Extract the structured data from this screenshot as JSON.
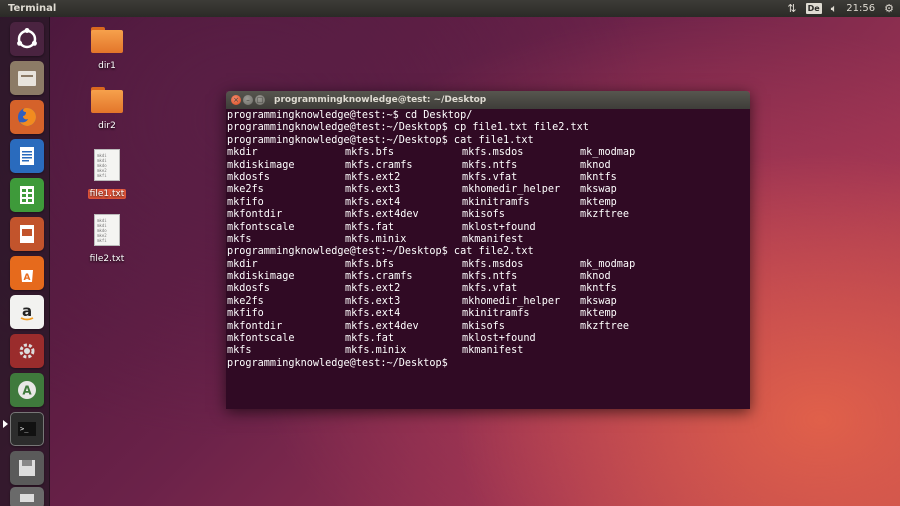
{
  "panel": {
    "app_title": "Terminal",
    "keyboard_layout": "De",
    "clock": "21:56"
  },
  "desktop": {
    "icons": [
      {
        "label": "dir1",
        "type": "folder"
      },
      {
        "label": "dir2",
        "type": "folder"
      },
      {
        "label": "file1.txt",
        "type": "text-file",
        "selected": true
      },
      {
        "label": "file2.txt",
        "type": "text-file"
      }
    ]
  },
  "launcher": {
    "items": [
      "ubuntu-dash-icon",
      "files-icon",
      "firefox-icon",
      "writer-icon",
      "calc-icon",
      "impress-icon",
      "software-center-icon",
      "amazon-icon",
      "settings-icon",
      "updater-icon",
      "terminal-icon",
      "save-icon",
      "printer-icon"
    ]
  },
  "terminal": {
    "title": "programmingknowledge@test: ~/Desktop",
    "lines": [
      "programmingknowledge@test:~$ cd Desktop/",
      "programmingknowledge@test:~/Desktop$ cp file1.txt file2.txt",
      "programmingknowledge@test:~/Desktop$ cat file1.txt"
    ],
    "listing1": [
      [
        "mkdir",
        "mkfs.bfs",
        "mkfs.msdos",
        "mk_modmap"
      ],
      [
        "mkdiskimage",
        "mkfs.cramfs",
        "mkfs.ntfs",
        "mknod"
      ],
      [
        "mkdosfs",
        "mkfs.ext2",
        "mkfs.vfat",
        "mkntfs"
      ],
      [
        "mke2fs",
        "mkfs.ext3",
        "mkhomedir_helper",
        "mkswap"
      ],
      [
        "mkfifo",
        "mkfs.ext4",
        "mkinitramfs",
        "mktemp"
      ],
      [
        "mkfontdir",
        "mkfs.ext4dev",
        "mkisofs",
        "mkzftree"
      ],
      [
        "mkfontscale",
        "mkfs.fat",
        "mklost+found",
        ""
      ],
      [
        "mkfs",
        "mkfs.minix",
        "mkmanifest",
        ""
      ]
    ],
    "cmd2": "programmingknowledge@test:~/Desktop$ cat file2.txt",
    "listing2": [
      [
        "mkdir",
        "mkfs.bfs",
        "mkfs.msdos",
        "mk_modmap"
      ],
      [
        "mkdiskimage",
        "mkfs.cramfs",
        "mkfs.ntfs",
        "mknod"
      ],
      [
        "mkdosfs",
        "mkfs.ext2",
        "mkfs.vfat",
        "mkntfs"
      ],
      [
        "mke2fs",
        "mkfs.ext3",
        "mkhomedir_helper",
        "mkswap"
      ],
      [
        "mkfifo",
        "mkfs.ext4",
        "mkinitramfs",
        "mktemp"
      ],
      [
        "mkfontdir",
        "mkfs.ext4dev",
        "mkisofs",
        "mkzftree"
      ],
      [
        "mkfontscale",
        "mkfs.fat",
        "mklost+found",
        ""
      ],
      [
        "mkfs",
        "mkfs.minix",
        "mkmanifest",
        ""
      ]
    ],
    "prompt": "programmingknowledge@test:~/Desktop$"
  }
}
